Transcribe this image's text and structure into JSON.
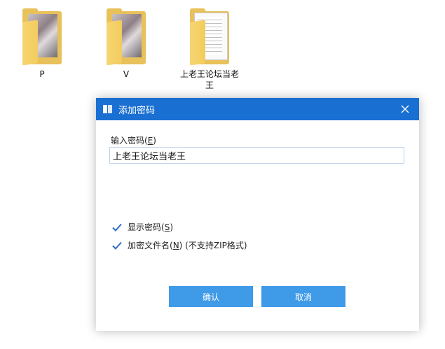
{
  "desktop": {
    "folders": [
      {
        "label": "P"
      },
      {
        "label": "V"
      },
      {
        "label_line1": "上老王论坛当老",
        "label_line2": "王"
      }
    ]
  },
  "dialog": {
    "title": "添加密码",
    "password_label": "输入密码(",
    "password_label_key": "E",
    "password_label_end": ")",
    "password_value": "上老王论坛当老王",
    "show_password": {
      "checked": true,
      "label": "显示密码(",
      "key": "S",
      "label_end": ")"
    },
    "encrypt_names": {
      "checked": true,
      "label": "加密文件名(",
      "key": "N",
      "label_end": ") (不支持ZIP格式)"
    },
    "ok_label": "确认",
    "cancel_label": "取消"
  },
  "colors": {
    "titlebar": "#1a6fd2",
    "button": "#3f9ae8",
    "checkmark": "#2a6cc4"
  }
}
